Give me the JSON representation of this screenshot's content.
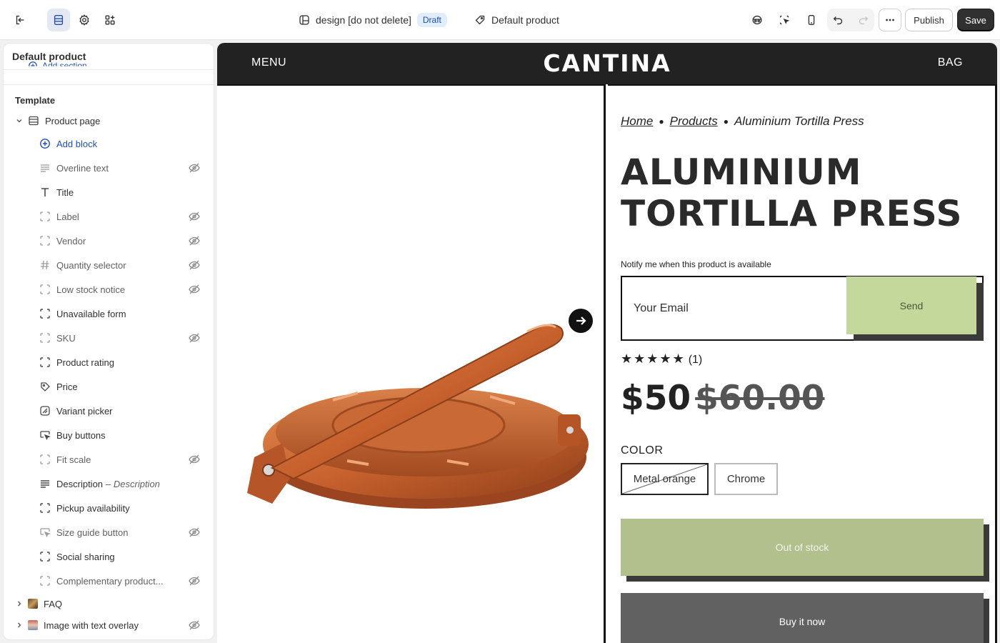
{
  "topbar": {
    "theme_name": "design [do not delete]",
    "status_badge": "Draft",
    "template_name": "Default product",
    "publish_label": "Publish",
    "save_label": "Save"
  },
  "sidebar": {
    "header": "Default product",
    "peek_text": "Add section",
    "section_title": "Template",
    "group_label": "Product page",
    "add_block_label": "Add block",
    "blocks": [
      {
        "label": "Overline text",
        "icon": "text-lines-icon",
        "hidden": true
      },
      {
        "label": "Title",
        "icon": "title-t-icon",
        "hidden": false
      },
      {
        "label": "Label",
        "icon": "block-frame-icon",
        "hidden": true
      },
      {
        "label": "Vendor",
        "icon": "block-frame-icon",
        "hidden": true
      },
      {
        "label": "Quantity selector",
        "icon": "hash-icon",
        "hidden": true
      },
      {
        "label": "Low stock notice",
        "icon": "block-frame-icon",
        "hidden": true
      },
      {
        "label": "Unavailable form",
        "icon": "block-frame-icon",
        "hidden": false
      },
      {
        "label": "SKU",
        "icon": "block-frame-icon",
        "hidden": true
      },
      {
        "label": "Product rating",
        "icon": "block-frame-icon",
        "hidden": false
      },
      {
        "label": "Price",
        "icon": "price-tag-icon",
        "hidden": false
      },
      {
        "label": "Variant picker",
        "icon": "variant-icon",
        "hidden": false
      },
      {
        "label": "Buy buttons",
        "icon": "cursor-button-icon",
        "hidden": false
      },
      {
        "label": "Fit scale",
        "icon": "block-frame-icon",
        "hidden": true
      },
      {
        "label": "Description",
        "sub": "– Description",
        "icon": "text-lines-icon",
        "hidden": false
      },
      {
        "label": "Pickup availability",
        "icon": "block-frame-icon",
        "hidden": false
      },
      {
        "label": "Size guide button",
        "icon": "cursor-button-icon",
        "hidden": true
      },
      {
        "label": "Social sharing",
        "icon": "block-frame-icon",
        "hidden": false
      },
      {
        "label": "Complementary product...",
        "icon": "block-frame-icon",
        "hidden": true
      }
    ],
    "sections": [
      {
        "label": "FAQ",
        "hidden": false
      },
      {
        "label": "Image with text overlay",
        "hidden": true
      }
    ]
  },
  "store": {
    "menu": "MENU",
    "logo": "CANTINA",
    "bag": "BAG",
    "breadcrumb": [
      "Home",
      "Products",
      "Aluminium Tortilla Press"
    ],
    "title_line1": "ALUMINIUM",
    "title_line2": "TORTILLA PRESS",
    "notify_label": "Notify me when this product is available",
    "email_placeholder": "Your Email",
    "send_label": "Send",
    "stars": "★★★★★",
    "rating_count": "(1)",
    "rating_value": 5,
    "price": "$50",
    "compare_price": "$60.00",
    "color_label": "COLOR",
    "color_options": [
      "Metal orange",
      "Chrome"
    ],
    "selected_color": "Metal orange",
    "out_of_stock_label": "Out of stock",
    "buy_now_label": "Buy it now"
  },
  "colors": {
    "accent_blue": "#1f4fb0",
    "send_green": "#c5d89c",
    "oos_green": "#b2c08e",
    "product_orange": "#c8622e"
  }
}
